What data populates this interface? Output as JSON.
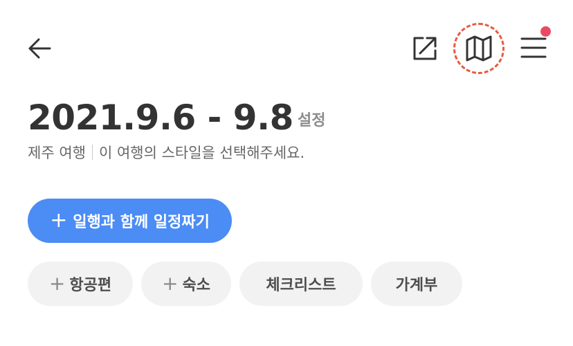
{
  "header": {
    "back_icon": "arrow-left-icon",
    "share_icon": "external-share-icon",
    "map_icon": "folded-map-icon",
    "menu_icon": "hamburger-menu-icon",
    "has_notification": true
  },
  "trip": {
    "dates": "2021.9.6 - 9.8",
    "settings_label": "설정",
    "destination": "제주 여행",
    "style_prompt": "이 여행의 스타일을 선택해주세요."
  },
  "actions": {
    "plus_symbol": "+",
    "plan_together_label": "일행과 함께 일정짜기"
  },
  "chips": [
    {
      "label": "항공편",
      "has_plus": true
    },
    {
      "label": "숙소",
      "has_plus": true
    },
    {
      "label": "체크리스트",
      "has_plus": false
    },
    {
      "label": "가계부",
      "has_plus": false
    }
  ],
  "colors": {
    "primary": "#4b8cf5",
    "highlight": "#e85a3c",
    "notification": "#ec4a64",
    "chip_bg": "#f2f2f2",
    "text_dark": "#333333"
  }
}
